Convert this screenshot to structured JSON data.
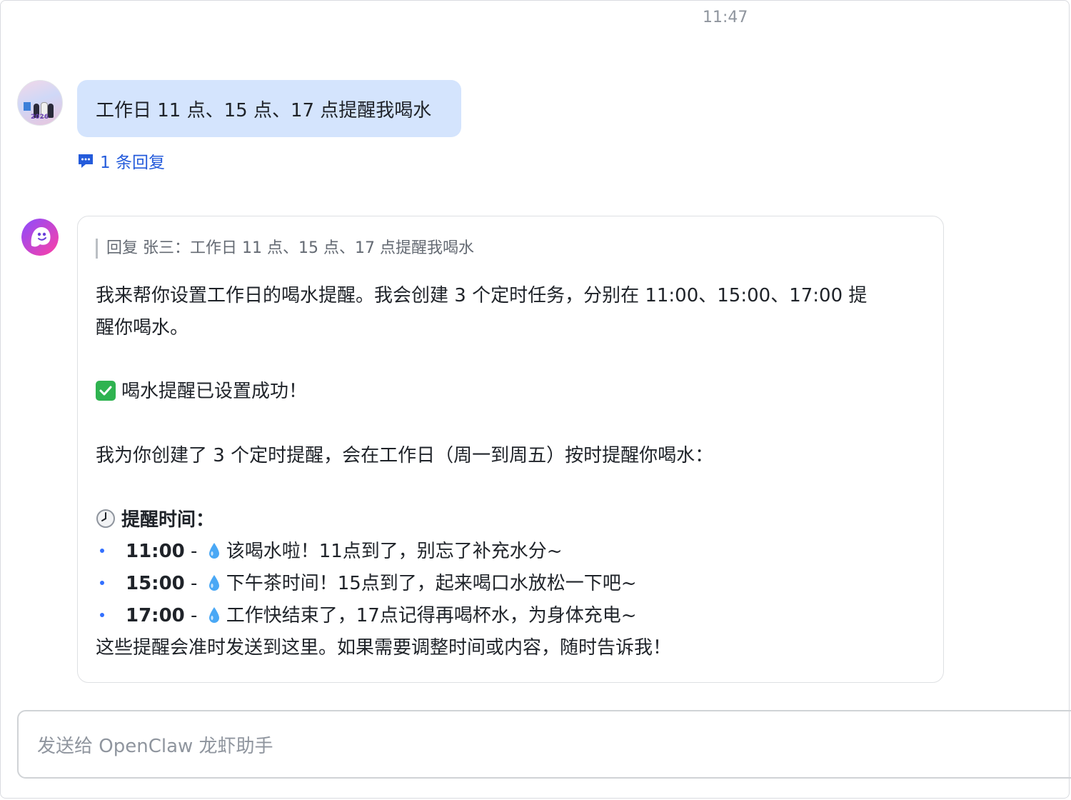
{
  "header": {
    "timestamp": "11:47"
  },
  "user_message": {
    "avatar_year": "2026",
    "text": "工作日 11 点、15 点、17 点提醒我喝水",
    "reply_count_label": "1 条回复"
  },
  "bot_message": {
    "quote": "回复 张三：工作日 11 点、15 点、17 点提醒我喝水",
    "intro_line1": "我来帮你设置工作日的喝水提醒。我会创建 3 个定时任务，分别在 11:00、15:00、17:00 提",
    "intro_line2": "醒你喝水。",
    "success": "喝水提醒已设置成功！",
    "created": "我为你创建了 3 个定时提醒，会在工作日（周一到周五）按时提醒你喝水：",
    "times_heading": "提醒时间：",
    "reminders": [
      {
        "time": "11:00",
        "sep": " - ",
        "text": "该喝水啦！11点到了，别忘了补充水分~"
      },
      {
        "time": "15:00",
        "sep": " - ",
        "text": "下午茶时间！15点到了，起来喝口水放松一下吧~"
      },
      {
        "time": "17:00",
        "sep": " - ",
        "text": "工作快结束了，17点记得再喝杯水，为身体充电~"
      }
    ],
    "closing": "这些提醒会准时发送到这里。如果需要调整时间或内容，随时告诉我！"
  },
  "composer": {
    "placeholder": "发送给 OpenClaw 龙虾助手"
  },
  "colors": {
    "user_bubble": "#d4e4fd",
    "link": "#245bdb",
    "bullet": "#3370ff",
    "check": "#2fb350"
  },
  "icons": [
    "reply-comment-icon",
    "check-icon",
    "clock-icon",
    "water-drop-icon",
    "bot-ghost-icon"
  ]
}
